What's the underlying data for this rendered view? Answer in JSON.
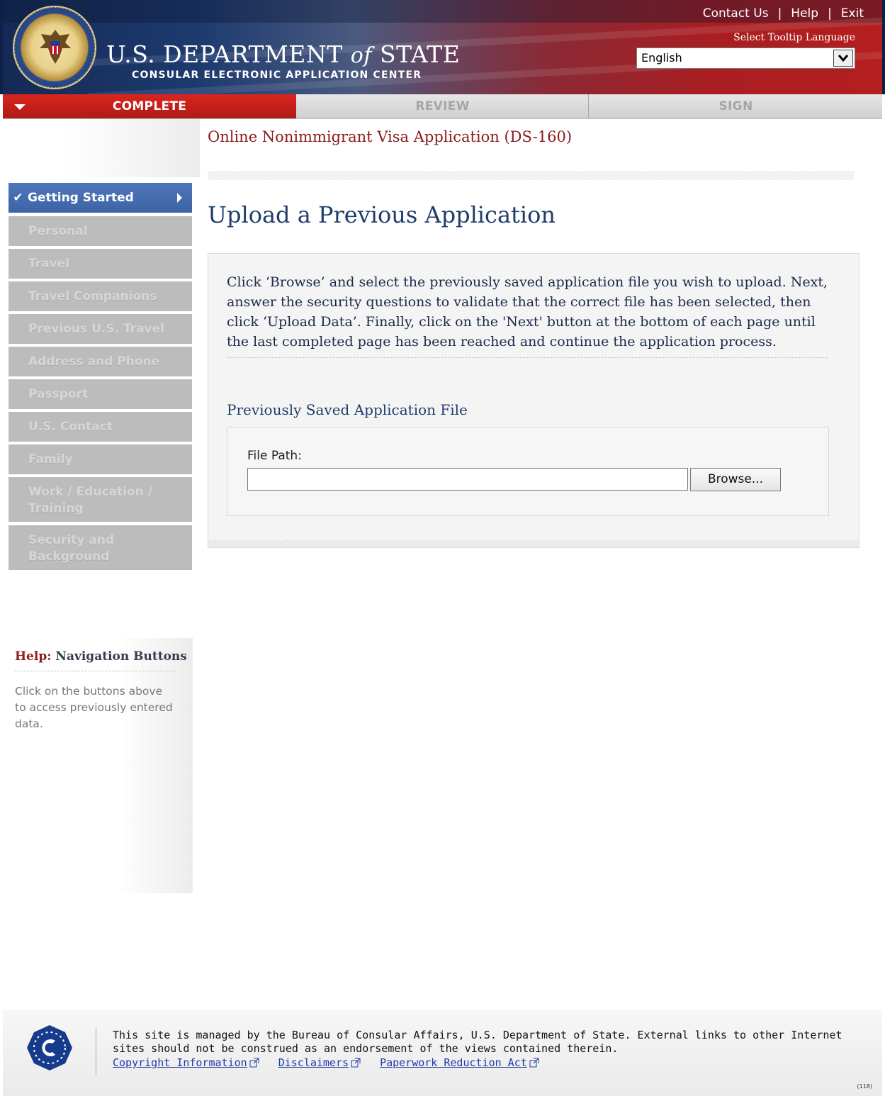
{
  "header": {
    "dept_title_prefix": "U.S. DEPARTMENT ",
    "dept_title_of": "of",
    "dept_title_suffix": " STATE",
    "dept_subtitle": "CONSULAR ELECTRONIC APPLICATION CENTER",
    "links": [
      {
        "label": "Contact Us"
      },
      {
        "label": "Help"
      },
      {
        "label": "Exit"
      }
    ],
    "tooltip_label": "Select Tooltip Language",
    "language_selected": "English"
  },
  "steps": [
    {
      "label": "COMPLETE",
      "state": "active"
    },
    {
      "label": "REVIEW",
      "state": "disabled"
    },
    {
      "label": "SIGN",
      "state": "disabled"
    }
  ],
  "sidebar": {
    "items": [
      {
        "label": "Getting Started",
        "active": true,
        "icon": "check-icon"
      },
      {
        "label": "Personal"
      },
      {
        "label": "Travel"
      },
      {
        "label": "Travel Companions"
      },
      {
        "label": "Previous U.S. Travel"
      },
      {
        "label": "Address and Phone"
      },
      {
        "label": "Passport"
      },
      {
        "label": "U.S. Contact"
      },
      {
        "label": "Family"
      },
      {
        "label": "Work / Education / Training"
      },
      {
        "label": "Security and Background"
      }
    ],
    "help_keyword": "Help:",
    "help_title": " Navigation Buttons",
    "help_text": "Click on the buttons above to access previously entered data."
  },
  "main": {
    "form_title": "Online Nonimmigrant Visa Application (DS-160)",
    "page_title": "Upload a Previous Application",
    "instructions": "Click ‘Browse’ and select the previously saved application file you wish to upload. Next, answer the security questions to validate that the correct file has been selected, then click ‘Upload Data’. Finally, click on the 'Next' button at the bottom of each page until the last completed page has been reached and continue the application process.",
    "section_title": "Previously Saved Application File",
    "file_path_label": "File Path:",
    "file_path_value": "",
    "browse_label": "Browse..."
  },
  "footer": {
    "text": "This site is managed by the Bureau of Consular Affairs, U.S. Department of State. External links to other Internet sites should not be construed as an endorsement of the views contained therein.",
    "links": [
      {
        "label": "Copyright Information"
      },
      {
        "label": "Disclaimers"
      },
      {
        "label": "Paperwork Reduction Act"
      }
    ],
    "code": "(118)"
  },
  "colors": {
    "header_blue": "#1d3a6e",
    "header_red": "#b51e1e",
    "step_active": "#c81f19",
    "nav_active": "#4a72b5",
    "nav_disabled": "#bcbcbc",
    "title_red": "#8b1a1a",
    "title_blue": "#1f3c6b",
    "link_blue": "#1d3ca8"
  }
}
